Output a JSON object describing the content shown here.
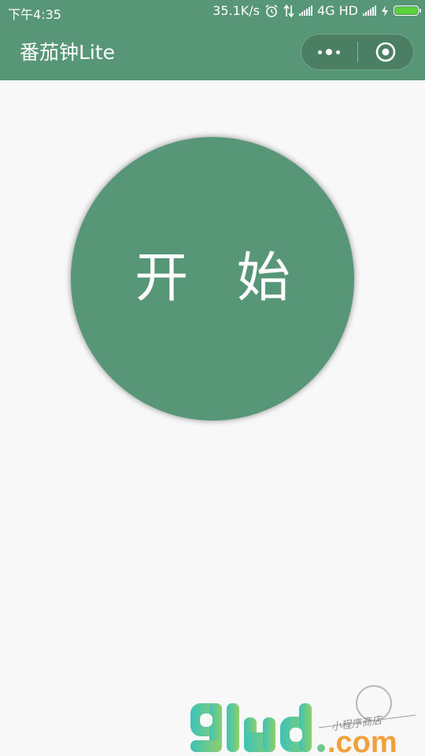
{
  "status_bar": {
    "time": "下午4:35",
    "network_speed": "35.1K/s",
    "network_type": "4G HD",
    "icons": [
      "alarm-icon",
      "data-transfer-icon",
      "signal-icon",
      "signal-icon",
      "charging-icon",
      "battery-icon"
    ],
    "battery_color": "#58d13a"
  },
  "nav": {
    "title": "番茄钟Lite",
    "menu_icon": "more-dots-icon",
    "close_icon": "close-target-icon",
    "background": "#579676"
  },
  "main": {
    "start_label": "开 始",
    "button_color": "#579676"
  },
  "watermark": {
    "logo_text": "91ud",
    "domain_text": ".com",
    "tagline": "小程序商店"
  }
}
